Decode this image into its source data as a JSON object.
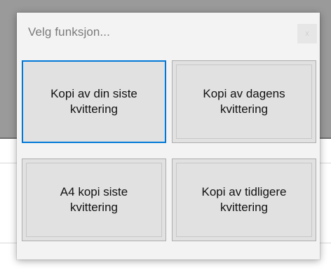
{
  "dialog": {
    "title": "Velg funksjon...",
    "close_label": "x",
    "buttons": [
      {
        "label": "Kopi av din siste\nkvittering",
        "focused": true
      },
      {
        "label": "Kopi av dagens\nkvittering",
        "focused": false
      },
      {
        "label": "A4 kopi siste\nkvittering",
        "focused": false
      },
      {
        "label": "Kopi av tidligere\nkvittering",
        "focused": false
      }
    ]
  },
  "colors": {
    "focus_border": "#0078d7",
    "button_face": "#e1e1e1",
    "dialog_bg": "#f3f3f3",
    "backdrop": "#9a9a9a"
  },
  "icons": {
    "close": "close-icon"
  }
}
